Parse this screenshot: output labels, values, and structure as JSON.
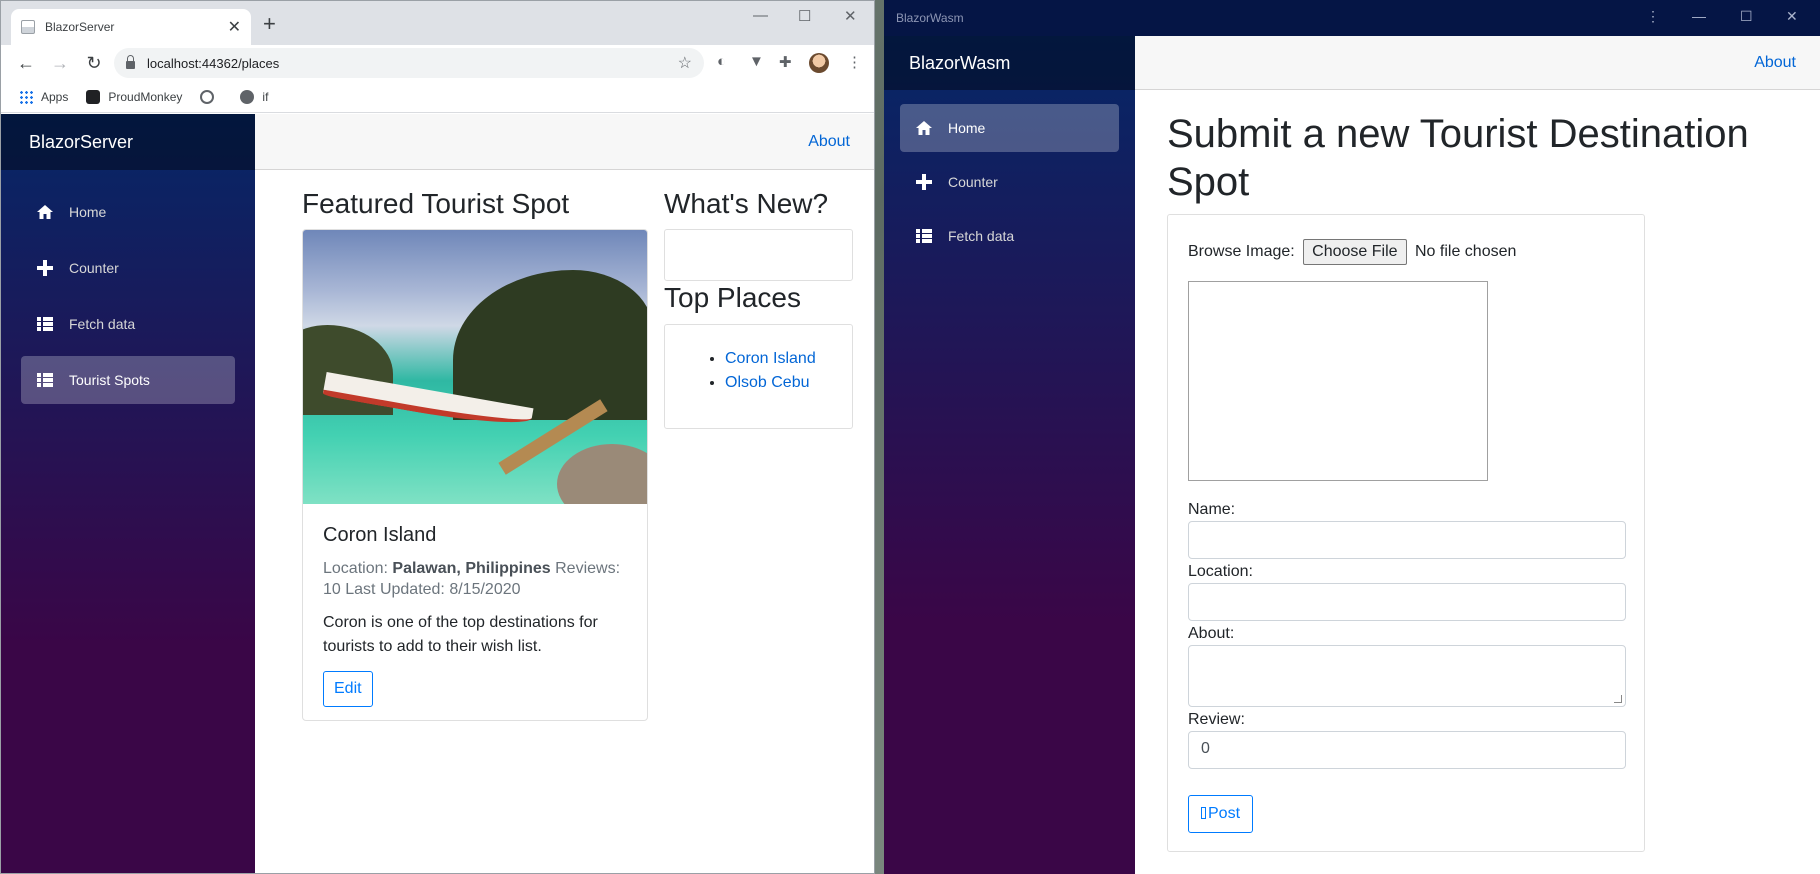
{
  "left_window": {
    "tab_title": "BlazorServer",
    "url": "localhost:44362/places",
    "bookmarks": [
      {
        "label": "Apps",
        "icon": "apps-grid-icon"
      },
      {
        "label": "ProudMonkey",
        "icon": "proudmonkey-icon"
      },
      {
        "label": "",
        "icon": "site-icon"
      },
      {
        "label": "if",
        "icon": "globe-icon"
      }
    ],
    "app": {
      "brand": "BlazorServer",
      "about": "About",
      "nav": [
        {
          "label": "Home",
          "icon": "home-icon",
          "active": false
        },
        {
          "label": "Counter",
          "icon": "plus-icon",
          "active": false
        },
        {
          "label": "Fetch data",
          "icon": "list-icon",
          "active": false
        },
        {
          "label": "Tourist Spots",
          "icon": "list-icon",
          "active": true
        }
      ],
      "featured_heading": "Featured Tourist Spot",
      "featured": {
        "name": "Coron Island",
        "location_label": "Location:",
        "location": "Palawan, Philippines",
        "reviews_label": "Reviews:",
        "reviews": "10",
        "updated_label": "Last Updated:",
        "updated": "8/15/2020",
        "description": "Coron is one of the top destinations for tourists to add to their wish list.",
        "edit": "Edit"
      },
      "whats_new_heading": "What's New?",
      "top_places_heading": "Top Places",
      "top_places": [
        "Coron Island",
        "Olsob Cebu"
      ]
    }
  },
  "right_window": {
    "title": "BlazorWasm",
    "app": {
      "brand": "BlazorWasm",
      "about": "About",
      "nav": [
        {
          "label": "Home",
          "icon": "home-icon",
          "active": true
        },
        {
          "label": "Counter",
          "icon": "plus-icon",
          "active": false
        },
        {
          "label": "Fetch data",
          "icon": "list-icon",
          "active": false
        }
      ],
      "heading": "Submit a new Tourist Destination Spot",
      "browse_label": "Browse Image:",
      "choose_file": "Choose File",
      "no_file": "No file chosen",
      "name_label": "Name:",
      "name_value": "",
      "location_label": "Location:",
      "location_value": "",
      "about_label": "About:",
      "about_value": "",
      "review_label": "Review:",
      "review_value": "0",
      "post": "Post"
    }
  }
}
